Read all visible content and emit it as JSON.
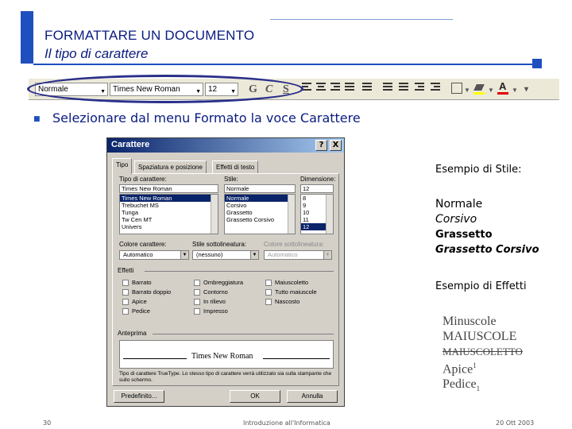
{
  "header": {
    "title": "FORMATTARE UN DOCUMENTO",
    "subtitle": "Il tipo di carattere"
  },
  "toolbar": {
    "style_value": "Normale",
    "font_value": "Times New Roman",
    "size_value": "12",
    "bold_label": "G",
    "italic_label": "C",
    "underline_label": "S",
    "font_color_label": "A"
  },
  "bullet": {
    "text_prefix": "Selezionare dal menu ",
    "menu_name": "Formato",
    "text_middle": " la voce ",
    "item_name": "Carattere"
  },
  "dialog": {
    "title": "Carattere",
    "help_label": "?",
    "close_label": "X",
    "tabs": [
      "Tipo",
      "Spaziatura e posizione",
      "Effetti di testo"
    ],
    "font_label": "Tipo di carattere:",
    "font_value": "Times New Roman",
    "font_list": [
      "Times New Roman",
      "Trebuchet MS",
      "Tunga",
      "Tw Cen MT",
      "Univers"
    ],
    "style_label": "Stile:",
    "style_value": "Normale",
    "style_list": [
      "Normale",
      "Corsivo",
      "Grassetto",
      "Grassetto Corsivo"
    ],
    "size_label": "Dimensione:",
    "size_value": "12",
    "size_list": [
      "8",
      "9",
      "10",
      "11",
      "12"
    ],
    "color_label": "Colore carattere:",
    "color_value": "Automatico",
    "underline_label": "Stile sottolineatura:",
    "underline_value": "(nessuno)",
    "underline_color_label": "Colore sottolineatura:",
    "underline_color_value": "Automatico",
    "effects_label": "Effetti",
    "effects": [
      "Barrato",
      "Ombreggiatura",
      "Maiuscoletto",
      "Barrato doppio",
      "Contorno",
      "Tutto maiuscole",
      "Apice",
      "In rilievo",
      "Nascosto",
      "Pedice",
      "Impresso"
    ],
    "preview_label": "Anteprima",
    "preview_text": "Times New Roman",
    "preview_note": "Tipo di carattere TrueType. Lo stesso tipo di carattere verrà utilizzato sia sulla stampante che sullo schermo.",
    "btn_default": "Predefinito...",
    "btn_ok": "OK",
    "btn_cancel": "Annulla"
  },
  "examples": {
    "style_heading": "Esempio di Stile:",
    "normal": "Normale",
    "italic": "Corsivo",
    "bold": "Grassetto",
    "bold_italic": "Grassetto Corsivo",
    "effects_heading": "Esempio di Effetti",
    "lowercase": "Minuscole",
    "uppercase": "MAIUSCOLE",
    "smallcaps": "MAIUSCOLETTO",
    "apice_word": "Apice",
    "apice_sup": "1",
    "pedice_word": "Pedice",
    "pedice_sub": "1"
  },
  "footer": {
    "page_number": "30",
    "course": "Introduzione all'Informatica",
    "date": "20 Ott 2003"
  },
  "colors": {
    "accent": "#1f4fbf",
    "title_text": "#0a1b80"
  }
}
